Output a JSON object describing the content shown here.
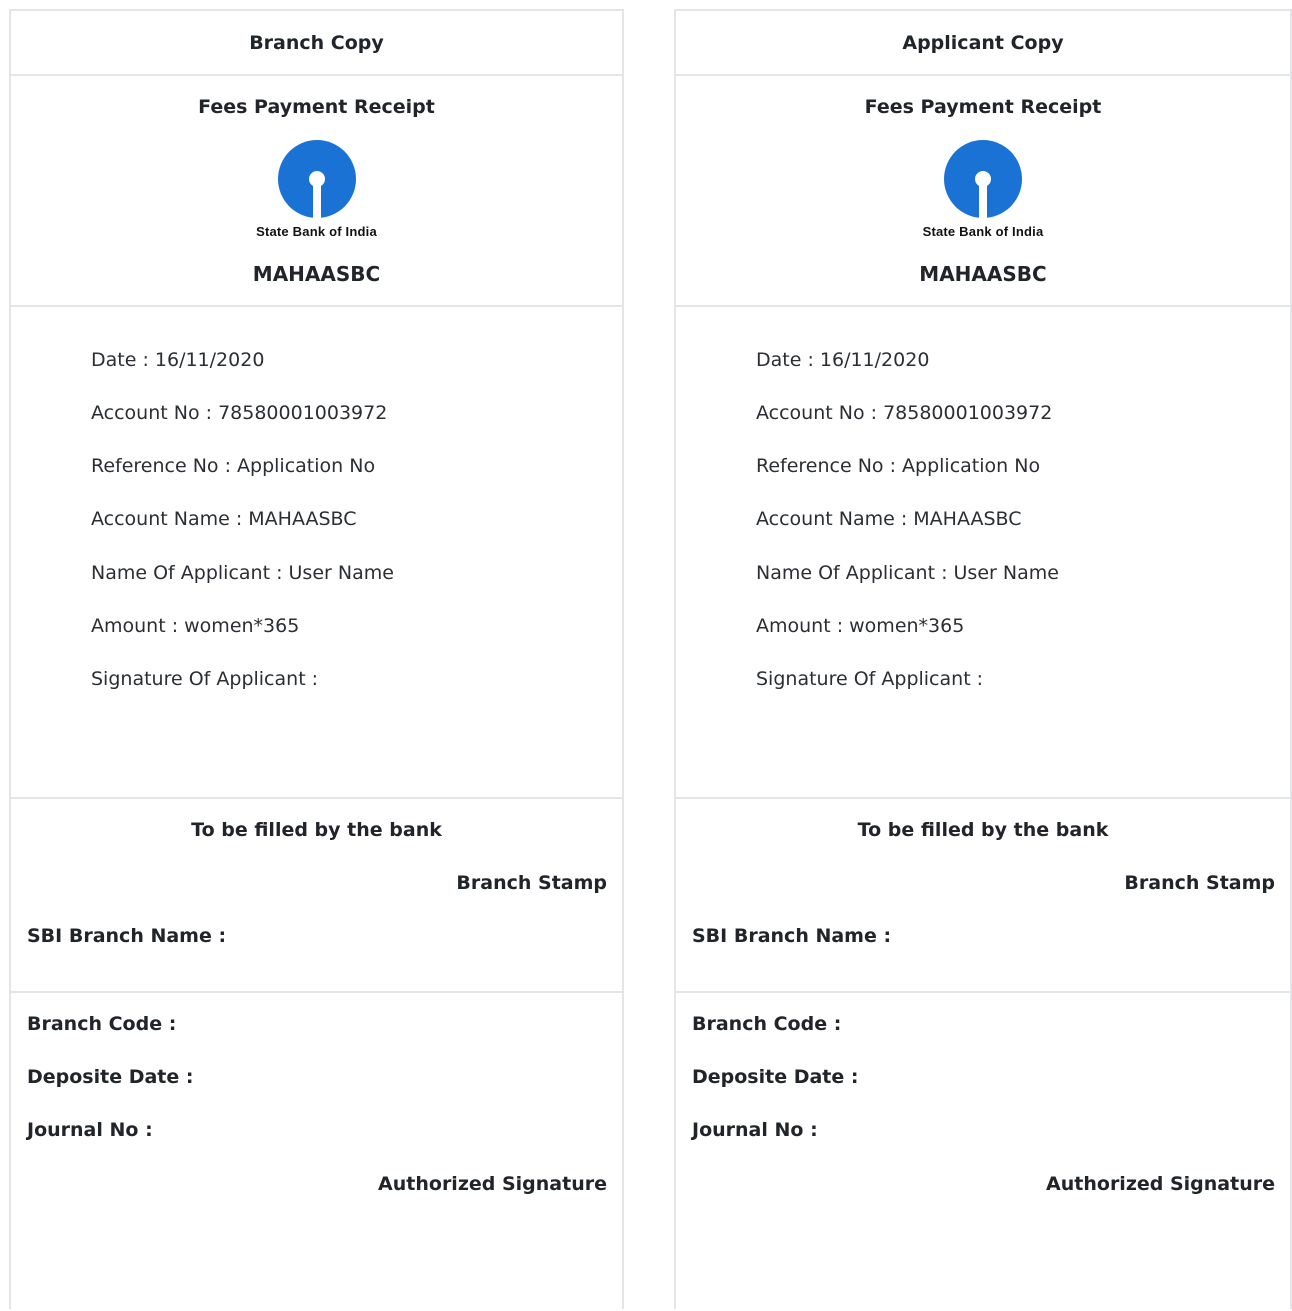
{
  "receipts": [
    {
      "copy_label": "Branch Copy",
      "title": "Fees Payment Receipt",
      "logo_text": "State Bank of India",
      "org_name": "MAHAASBC",
      "details": {
        "date": "Date : 16/11/2020",
        "account_no": "Account No : 78580001003972",
        "reference_no": "Reference No : Application No",
        "account_name": "Account Name : MAHAASBC",
        "applicant_name": "Name Of Applicant : User Name",
        "amount": "Amount : women*365",
        "signature": "Signature Of Applicant :"
      },
      "bank_section": {
        "title": "To be filled by the bank",
        "stamp": "Branch Stamp",
        "branch_name": "SBI Branch Name :",
        "branch_code": "Branch Code :",
        "deposit_date": "Deposite Date :",
        "journal_no": "Journal No :",
        "authorized_signature": "Authorized Signature"
      }
    },
    {
      "copy_label": "Applicant Copy",
      "title": "Fees Payment Receipt",
      "logo_text": "State Bank of India",
      "org_name": "MAHAASBC",
      "details": {
        "date": "Date : 16/11/2020",
        "account_no": "Account No : 78580001003972",
        "reference_no": "Reference No : Application No",
        "account_name": "Account Name : MAHAASBC",
        "applicant_name": "Name Of Applicant : User Name",
        "amount": "Amount : women*365",
        "signature": "Signature Of Applicant :"
      },
      "bank_section": {
        "title": "To be filled by the bank",
        "stamp": "Branch Stamp",
        "branch_name": "SBI Branch Name :",
        "branch_code": "Branch Code :",
        "deposit_date": "Deposite Date :",
        "journal_no": "Journal No :",
        "authorized_signature": "Authorized Signature"
      }
    }
  ],
  "colors": {
    "sbi_blue": "#1a73d4",
    "border": "#e3e5e8",
    "text": "#212529"
  }
}
